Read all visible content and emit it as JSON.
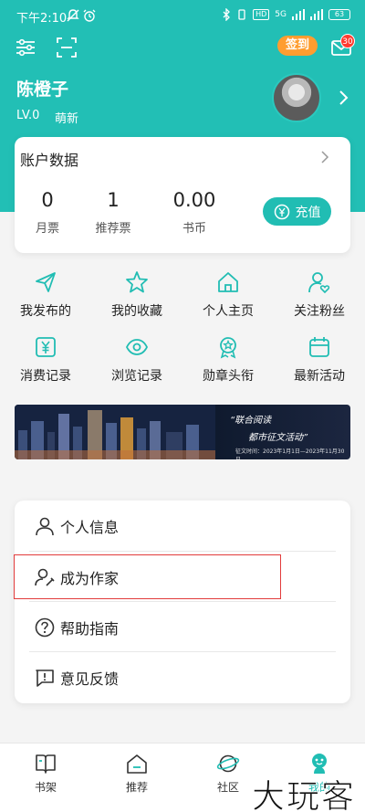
{
  "status_bar": {
    "time": "下午2:10",
    "network": "5G",
    "battery": "63",
    "hd": "HD"
  },
  "toolbar": {
    "settings_icon": "sliders-icon",
    "scan_icon": "scan-icon",
    "signin_label": "签到",
    "mail_badge": "30"
  },
  "profile": {
    "name": "陈橙子",
    "level": "LV.0",
    "level_name": "萌新"
  },
  "account": {
    "title": "账户数据",
    "stats": [
      {
        "value": "0",
        "label": "月票"
      },
      {
        "value": "1",
        "label": "推荐票"
      },
      {
        "value": "0.00",
        "label": "书币"
      }
    ],
    "recharge_label": "充值"
  },
  "grid": [
    {
      "label": "我发布的",
      "icon": "send-icon"
    },
    {
      "label": "我的收藏",
      "icon": "star-icon"
    },
    {
      "label": "个人主页",
      "icon": "home-icon"
    },
    {
      "label": "关注粉丝",
      "icon": "user-heart-icon"
    },
    {
      "label": "消费记录",
      "icon": "yen-icon"
    },
    {
      "label": "浏览记录",
      "icon": "eye-icon"
    },
    {
      "label": "勋章头衔",
      "icon": "medal-icon"
    },
    {
      "label": "最新活动",
      "icon": "calendar-icon"
    }
  ],
  "banner": {
    "title": "“联合阅读",
    "subtitle": "都市征文活动”",
    "period": "征文时间：2023年1月1日—2023年11月30日"
  },
  "menu": [
    {
      "label": "个人信息",
      "icon": "user-icon"
    },
    {
      "label": "成为作家",
      "icon": "author-icon"
    },
    {
      "label": "帮助指南",
      "icon": "help-icon"
    },
    {
      "label": "意见反馈",
      "icon": "feedback-icon"
    }
  ],
  "bottom_nav": [
    {
      "label": "书架",
      "icon": "bookshelf-icon"
    },
    {
      "label": "推荐",
      "icon": "recommend-icon"
    },
    {
      "label": "社区",
      "icon": "community-icon"
    },
    {
      "label": "我的",
      "icon": "profile-icon"
    }
  ],
  "watermark": "大玩客",
  "colors": {
    "accent": "#21bdb3",
    "header": "#22bfb5",
    "signin": "#ff9d2f",
    "badge": "#ff3b30",
    "highlight": "#e23b3b"
  }
}
